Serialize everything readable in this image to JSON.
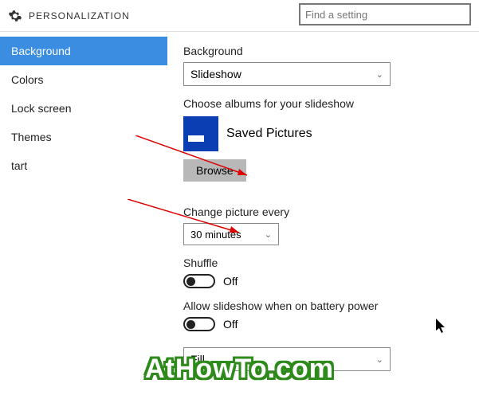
{
  "titlebar": {
    "title": "PERSONALIZATION"
  },
  "search": {
    "placeholder": "Find a setting"
  },
  "sidebar": {
    "items": [
      {
        "label": "Background"
      },
      {
        "label": "Colors"
      },
      {
        "label": "Lock screen"
      },
      {
        "label": "Themes"
      },
      {
        "label": "tart"
      }
    ]
  },
  "main": {
    "background_label": "Background",
    "background_value": "Slideshow",
    "choose_albums_label": "Choose albums for your slideshow",
    "album_name": "Saved Pictures",
    "browse_label": "Browse",
    "change_every_label": "Change picture every",
    "change_every_value": "30 minutes",
    "shuffle_label": "Shuffle",
    "shuffle_value": "Off",
    "battery_label": "Allow slideshow when on battery power",
    "battery_value": "Off",
    "fit_value": "Fill"
  },
  "watermark": "AtHowTo.com"
}
